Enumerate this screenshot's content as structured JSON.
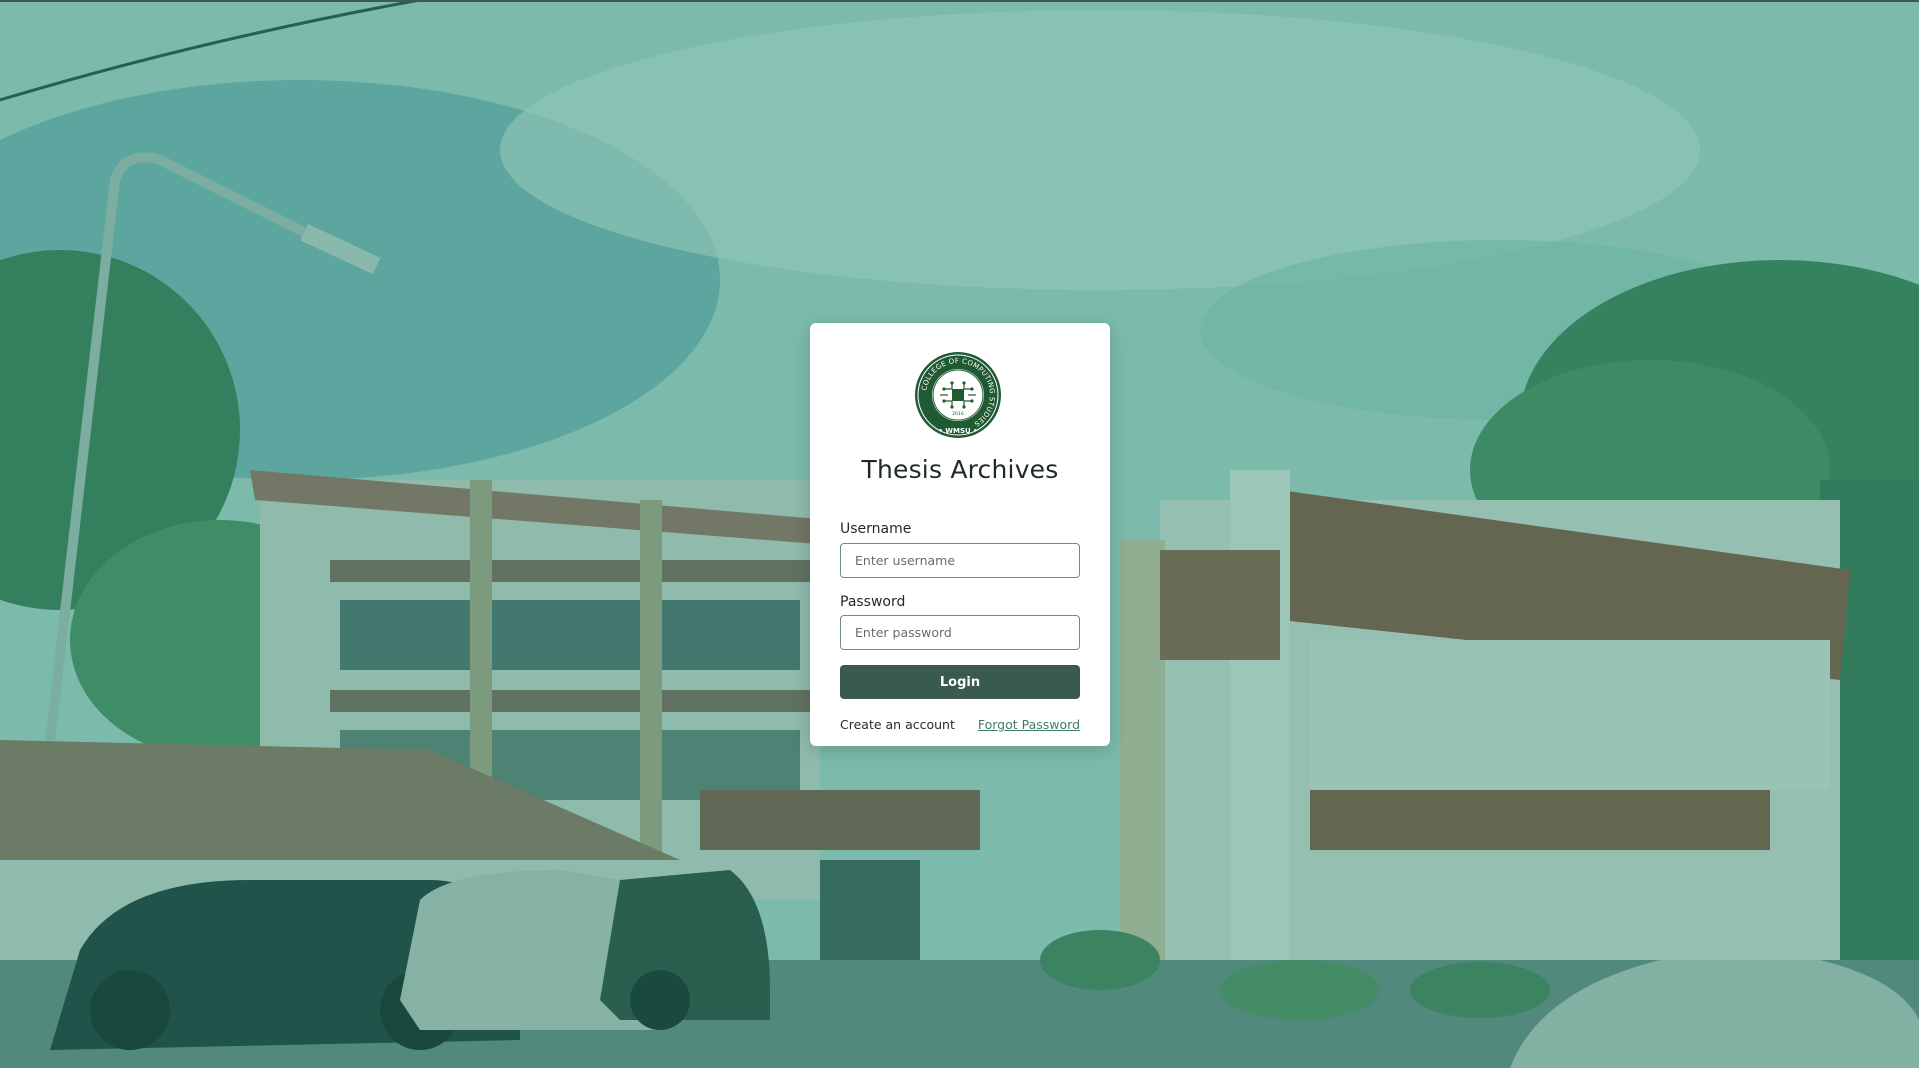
{
  "page": {
    "title": "Thesis Archives"
  },
  "logo": {
    "name": "college-of-computing-studies-seal",
    "ring_text": "COLLEGE OF COMPUTING STUDIES",
    "bottom_text": "WMSU",
    "year": "2016",
    "ring_color": "#1f5a33"
  },
  "form": {
    "username_label": "Username",
    "username_placeholder": "Enter username",
    "username_value": "",
    "password_label": "Password",
    "password_placeholder": "Enter password",
    "password_value": "",
    "login_label": "Login"
  },
  "links": {
    "create_account": "Create an account",
    "forgot_password": "Forgot Password"
  },
  "colors": {
    "overlay_tint": "#288c73",
    "button_bg": "#3a5a4e",
    "link_color": "#3f7d62",
    "card_bg": "#ffffff"
  }
}
